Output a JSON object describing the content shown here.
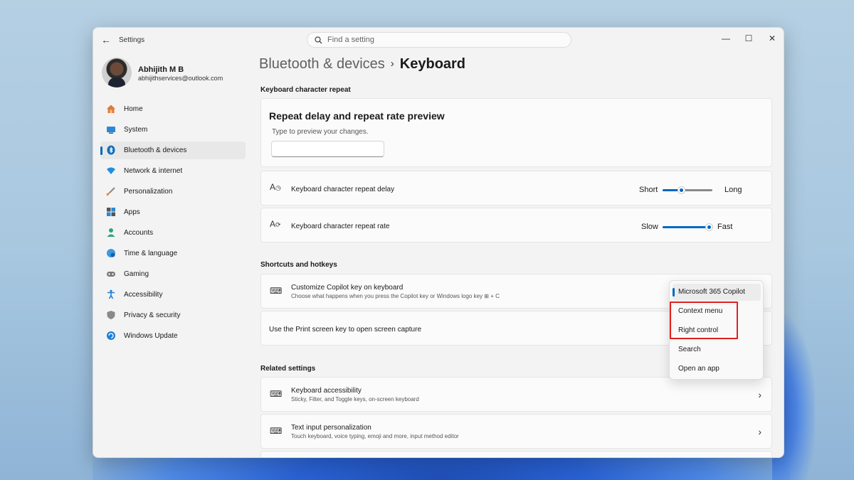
{
  "window": {
    "app_title": "Settings",
    "search_placeholder": "Find a setting"
  },
  "profile": {
    "name": "Abhijith M B",
    "email": "abhijithservices@outlook.com"
  },
  "sidebar": {
    "items": [
      {
        "label": "Home",
        "icon": "home-icon",
        "active": false
      },
      {
        "label": "System",
        "icon": "system-icon",
        "active": false
      },
      {
        "label": "Bluetooth & devices",
        "icon": "bluetooth-icon",
        "active": true
      },
      {
        "label": "Network & internet",
        "icon": "wifi-icon",
        "active": false
      },
      {
        "label": "Personalization",
        "icon": "brush-icon",
        "active": false
      },
      {
        "label": "Apps",
        "icon": "apps-icon",
        "active": false
      },
      {
        "label": "Accounts",
        "icon": "accounts-icon",
        "active": false
      },
      {
        "label": "Time & language",
        "icon": "globe-clock-icon",
        "active": false
      },
      {
        "label": "Gaming",
        "icon": "gamepad-icon",
        "active": false
      },
      {
        "label": "Accessibility",
        "icon": "accessibility-icon",
        "active": false
      },
      {
        "label": "Privacy & security",
        "icon": "shield-icon",
        "active": false
      },
      {
        "label": "Windows Update",
        "icon": "update-icon",
        "active": false
      }
    ]
  },
  "breadcrumb": {
    "parent": "Bluetooth & devices",
    "separator": "›",
    "current": "Keyboard"
  },
  "repeat_section": {
    "title": "Keyboard character repeat",
    "preview_title": "Repeat delay and repeat rate preview",
    "preview_sub": "Type to preview your changes.",
    "delay": {
      "label": "Keyboard character repeat delay",
      "min": "Short",
      "max": "Long",
      "value": 0.38
    },
    "rate": {
      "label": "Keyboard character repeat rate",
      "min": "Slow",
      "max": "Fast",
      "value": 0.93
    }
  },
  "shortcuts_section": {
    "title": "Shortcuts and hotkeys",
    "copilot_title": "Customize Copilot key on keyboard",
    "copilot_desc": "Choose what happens when you press the Copilot key or Windows logo key ⊞ + C",
    "printscreen_label": "Use the Print screen key to open screen capture"
  },
  "dropdown": {
    "options": [
      "Microsoft 365 Copilot",
      "Context menu",
      "Right control",
      "Search",
      "Open an app"
    ],
    "selected": "Microsoft 365 Copilot"
  },
  "related_section": {
    "title": "Related settings",
    "items": [
      {
        "title": "Keyboard accessibility",
        "desc": "Sticky, Filter, and Toggle keys, on-screen keyboard"
      },
      {
        "title": "Text input personalization",
        "desc": "Touch keyboard, voice typing, emoji and more, input method editor"
      }
    ]
  },
  "colors": {
    "accent": "#0067c0",
    "highlight": "#e0201f"
  }
}
